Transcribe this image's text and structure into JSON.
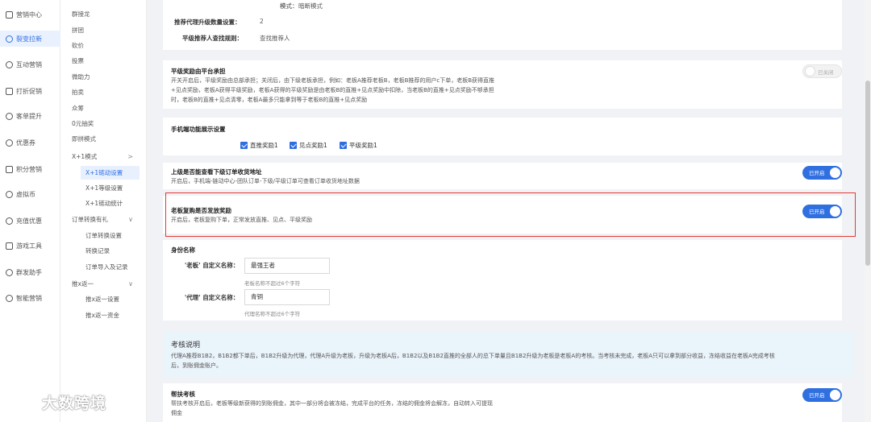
{
  "nav_main": [
    {
      "label": "营销中心",
      "icon": "cart-icon"
    },
    {
      "label": "裂变拉新",
      "icon": "fission-icon",
      "active": true
    },
    {
      "label": "互动营销",
      "icon": "chat-icon"
    },
    {
      "label": "打折促销",
      "icon": "discount-icon"
    },
    {
      "label": "客单提升",
      "icon": "order-icon"
    },
    {
      "label": "优惠券",
      "icon": "coupon-icon"
    },
    {
      "label": "积分营销",
      "icon": "points-icon"
    },
    {
      "label": "虚拟币",
      "icon": "coin-icon"
    },
    {
      "label": "充值优惠",
      "icon": "recharge-icon"
    },
    {
      "label": "游戏工具",
      "icon": "game-icon"
    },
    {
      "label": "群发助手",
      "icon": "broadcast-icon"
    },
    {
      "label": "智能营销",
      "icon": "smart-icon"
    }
  ],
  "nav_sub": [
    {
      "label": "群接龙"
    },
    {
      "label": "拼团"
    },
    {
      "label": "砍价"
    },
    {
      "label": "投票"
    },
    {
      "label": "微助力"
    },
    {
      "label": "拍卖"
    },
    {
      "label": "众筹"
    },
    {
      "label": "0元抽奖"
    },
    {
      "label": "即拼模式"
    },
    {
      "label": "X+1模式",
      "chevron": ">"
    },
    {
      "label": "X+1链动设置",
      "child": true,
      "active": true
    },
    {
      "label": "X+1等级设置",
      "child": true
    },
    {
      "label": "X+1链动统计",
      "child": true
    },
    {
      "label": "订单转换有礼",
      "chevron": "∨"
    },
    {
      "label": "订单转换设置",
      "child": true
    },
    {
      "label": "转换记录",
      "child": true
    },
    {
      "label": "订单导入及记录",
      "child": true
    },
    {
      "label": "推x返一",
      "chevron": "∨"
    },
    {
      "label": "推x返一设置",
      "child": true
    },
    {
      "label": "推x返一资金",
      "child": true
    }
  ],
  "top_card": {
    "mode_label": "模式：",
    "mode_value": "暗断模式",
    "upgrade_label": "推荐代理升级数量设置：",
    "upgrade_value": "2",
    "rule_label": "平级推荐人查找规则：",
    "rule_value": "查找推荐人"
  },
  "platform_card": {
    "title": "平级奖励由平台承担",
    "desc1": "开关开启后，平级奖励由总部承担；关闭后，由下级老板承担，例如：老板A推荐老板B，老板B推荐的用户c下单，老板B获得直推",
    "desc2": "+见点奖励，老板A获得平级奖励，老板A获得的平级奖励是由老板B的直推+见点奖励中扣除，当老板B的直推+见点奖励不够承担",
    "desc3": "时，老板B的直推+见点清零，老板A最多只能拿到等于老板B的直推+见点奖励",
    "toggle": "已关闭"
  },
  "mobile_card": {
    "title": "手机端功能展示设置",
    "checkboxes": [
      "直推奖励1",
      "见点奖励1",
      "平级奖励1"
    ]
  },
  "address_card": {
    "title": "上级是否能查看下级订单收货地址",
    "desc": "开启后，手机端-链动中心-团队订单-下级/平级订单可查看订单收货地址数据",
    "toggle": "已开启"
  },
  "rebuy_card": {
    "title": "老板复购是否发放奖励",
    "desc": "开启后，老板复购下单，正常发放直推、见点、平级奖励",
    "toggle": "已开启"
  },
  "identity_card": {
    "title": "身份名称",
    "boss_label": "'老板' 自定义名称：",
    "boss_value": "最强王者",
    "boss_hint": "老板名称不超过6个字符",
    "agent_label": "'代理' 自定义名称：",
    "agent_value": "青铜",
    "agent_hint": "代理名称不超过6个字符"
  },
  "info_card": {
    "title": "考核说明",
    "line1": "代理A推荐B1B2，B1B2都下单后，B1B2升级为代理，代理A升级为老板，升级为老板A后，B1B2以及B1B2直推的全部人的总下单量且B1B2升级为老板是老板A的考核。当考核未完成，老板A只可以拿到部分收益，冻结收益在老板A完成考核",
    "line2": "后，到账佣金账户。"
  },
  "assist_card": {
    "title": "帮扶考核",
    "desc1": "帮扶考核开启后，老板等级新获得的到账佣金，其中一部分将会被冻结，完成平台的任务，冻结的佣金将会解冻，自动转入可提现",
    "desc2": "佣金",
    "toggle": "已开启"
  },
  "watermark": {
    "text": "大数跨境"
  },
  "colors": {
    "accent": "#2f6fe0",
    "highlight": "#e53935",
    "info_bg": "#eaf4fb"
  }
}
